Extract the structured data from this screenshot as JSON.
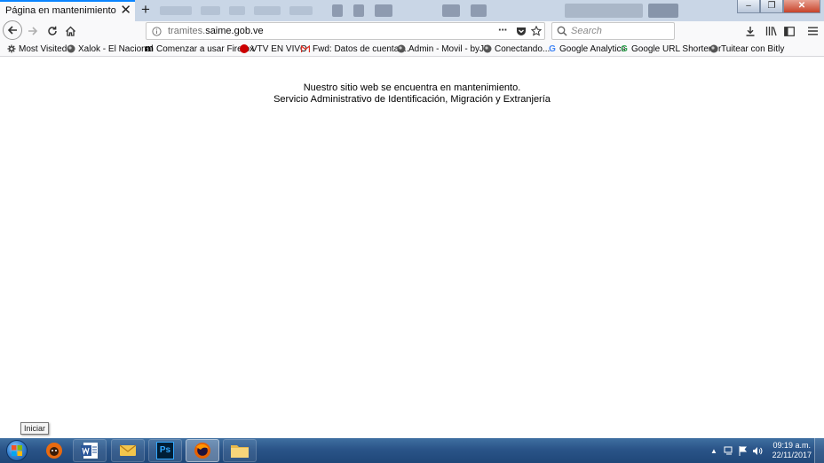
{
  "browser": {
    "tab_title": "Página en mantenimiento",
    "url_prefix": "tramites.",
    "url_domain": "saime.gob.ve",
    "search_placeholder": "Search"
  },
  "bookmarks": [
    {
      "label": "Most Visited",
      "icon": "gear-icon"
    },
    {
      "label": "Xalok - El Nacional",
      "icon": "globe-icon"
    },
    {
      "label": "Comenzar a usar Firefox",
      "icon": "mozilla-icon"
    },
    {
      "label": "VTV EN VIVO",
      "icon": "vtv-icon"
    },
    {
      "label": "Fwd: Datos de cuenta ...",
      "icon": "gmail-icon"
    },
    {
      "label": "Admin - Movil - byJL",
      "icon": "globe-icon"
    },
    {
      "label": "Conectando...",
      "icon": "globe-icon"
    },
    {
      "label": "Google Analytics",
      "icon": "google-icon"
    },
    {
      "label": "Google URL Shortener",
      "icon": "google-icon"
    },
    {
      "label": "Tuitear con Bitly",
      "icon": "globe-icon"
    }
  ],
  "page": {
    "line1": "Nuestro sitio web se encuentra en mantenimiento.",
    "line2": "Servicio Administrativo de Identificación, Migración y Extranjería"
  },
  "taskbar": {
    "tooltip": "Iniciar",
    "apps": [
      "gorilla-app-icon",
      "word-icon",
      "outlook-icon",
      "photoshop-icon",
      "firefox-icon",
      "folder-icon"
    ],
    "ps_label": "Ps",
    "time": "09:19 a.m.",
    "date": "22/11/2017"
  },
  "colors": {
    "accent": "#0a84ff",
    "taskbar": "#2a5488"
  }
}
